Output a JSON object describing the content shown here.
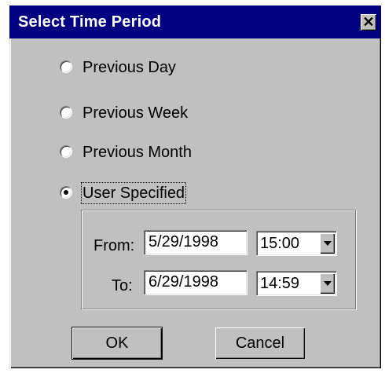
{
  "window": {
    "title": "Select Time Period",
    "close_glyph": "✕"
  },
  "options": [
    {
      "label": "Previous Day",
      "checked": false
    },
    {
      "label": "Previous Week",
      "checked": false
    },
    {
      "label": "Previous Month",
      "checked": false
    },
    {
      "label": "User Specified",
      "checked": true
    }
  ],
  "range": {
    "from": {
      "label": "From:",
      "date": "5/29/1998",
      "time": "15:00"
    },
    "to": {
      "label": "To:",
      "date": "6/29/1998",
      "time": "14:59"
    }
  },
  "buttons": {
    "ok": "OK",
    "cancel": "Cancel"
  }
}
